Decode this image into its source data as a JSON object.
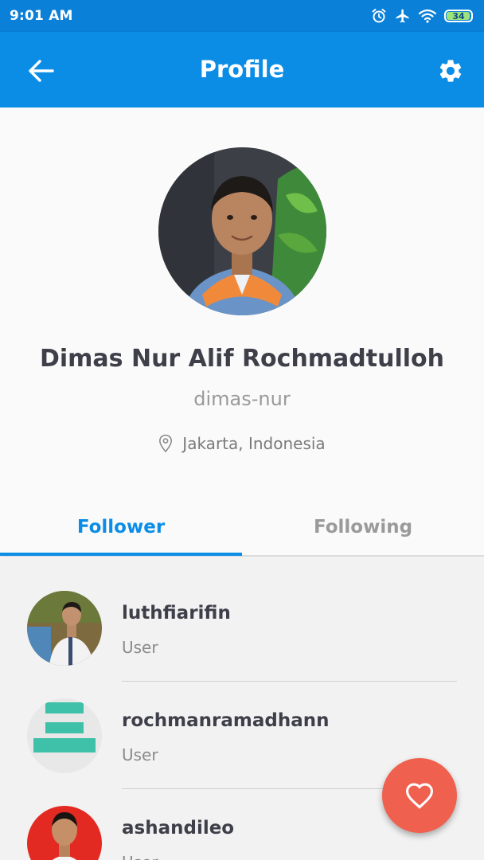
{
  "status_bar": {
    "time": "9:01 AM",
    "battery": "34",
    "icons": [
      "alarm-icon",
      "airplane-icon",
      "wifi-icon",
      "battery-icon"
    ]
  },
  "app_bar": {
    "title": "Profile",
    "back_icon": "back-arrow-icon",
    "settings_icon": "gear-icon",
    "color": "#0b8de6"
  },
  "profile": {
    "name": "Dimas Nur Alif Rochmadtulloh",
    "username": "dimas-nur",
    "location": "Jakarta, Indonesia",
    "location_icon": "location-pin-icon"
  },
  "tabs": [
    {
      "label": "Follower",
      "active": true
    },
    {
      "label": "Following",
      "active": false
    }
  ],
  "followers": [
    {
      "username": "luthfiarifin",
      "role": "User"
    },
    {
      "username": "rochmanramadhann",
      "role": "User"
    },
    {
      "username": "ashandileo",
      "role": "User"
    }
  ],
  "fab": {
    "icon": "heart-icon",
    "color": "#f0604f"
  }
}
